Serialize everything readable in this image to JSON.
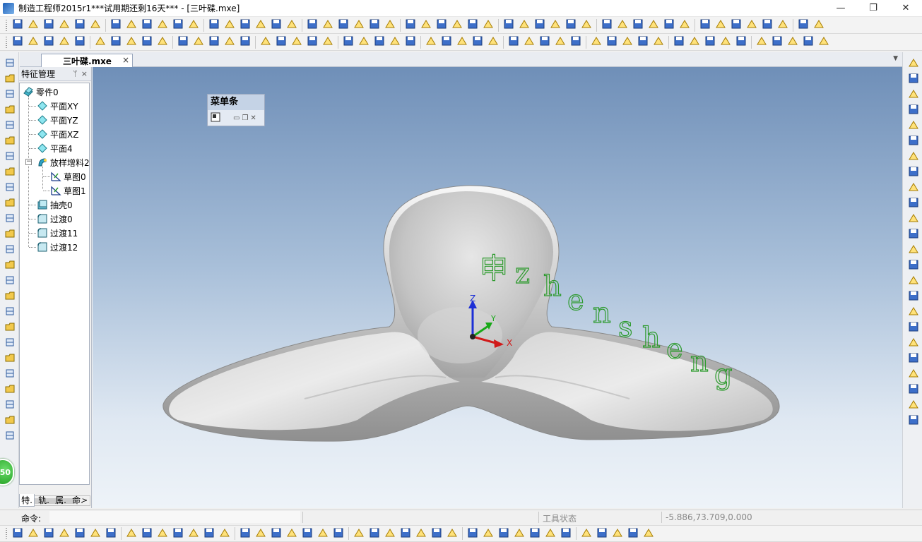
{
  "window": {
    "title": "制造工程师2015r1***试用期还剩16天*** - [三叶碟.mxe]",
    "minimize": "—",
    "maximize": "❐",
    "close": "✕"
  },
  "document_tab": {
    "label": "三叶碟.mxe",
    "close": "×",
    "dropdown": "▼"
  },
  "feature_panel": {
    "title": "特征管理",
    "pin": "ᛘ",
    "close": "×",
    "tree": [
      {
        "label": "零件0",
        "icon": "part-icon"
      },
      {
        "label": "平面XY",
        "icon": "plane-icon"
      },
      {
        "label": "平面YZ",
        "icon": "plane-icon"
      },
      {
        "label": "平面XZ",
        "icon": "plane-icon"
      },
      {
        "label": "平面4",
        "icon": "plane-icon"
      },
      {
        "label": "放样增料2",
        "icon": "loft-icon",
        "expanded": true
      },
      {
        "label": "草图0",
        "icon": "sketch-icon"
      },
      {
        "label": "草图1",
        "icon": "sketch-icon"
      },
      {
        "label": "抽壳0",
        "icon": "shell-icon"
      },
      {
        "label": "过渡0",
        "icon": "fillet-icon"
      },
      {
        "label": "过渡11",
        "icon": "fillet-icon"
      },
      {
        "label": "过渡12",
        "icon": "fillet-icon"
      }
    ],
    "tabs": [
      "特.",
      "轨.",
      "属.",
      "命."
    ],
    "scroll_left": "<",
    "scroll_right": ">"
  },
  "floating_menubar": {
    "title": "菜单条"
  },
  "viewport": {
    "watermark_chars": [
      "申",
      "z",
      "h",
      "e",
      "n",
      "s",
      "h",
      "e",
      "n",
      "g"
    ],
    "axis_labels": {
      "x": "X",
      "y": "Y",
      "z": "Z"
    },
    "colors": {
      "x_axis": "#d11a1a",
      "y_axis": "#18a818",
      "z_axis": "#1c2fd6",
      "watermark": "#2b9a2b"
    }
  },
  "status_bar": {
    "command_label": "命令:",
    "tool_state": "工具状态",
    "coordinates": "-5.886,73.709,0.000"
  },
  "badge": {
    "value": "50"
  }
}
